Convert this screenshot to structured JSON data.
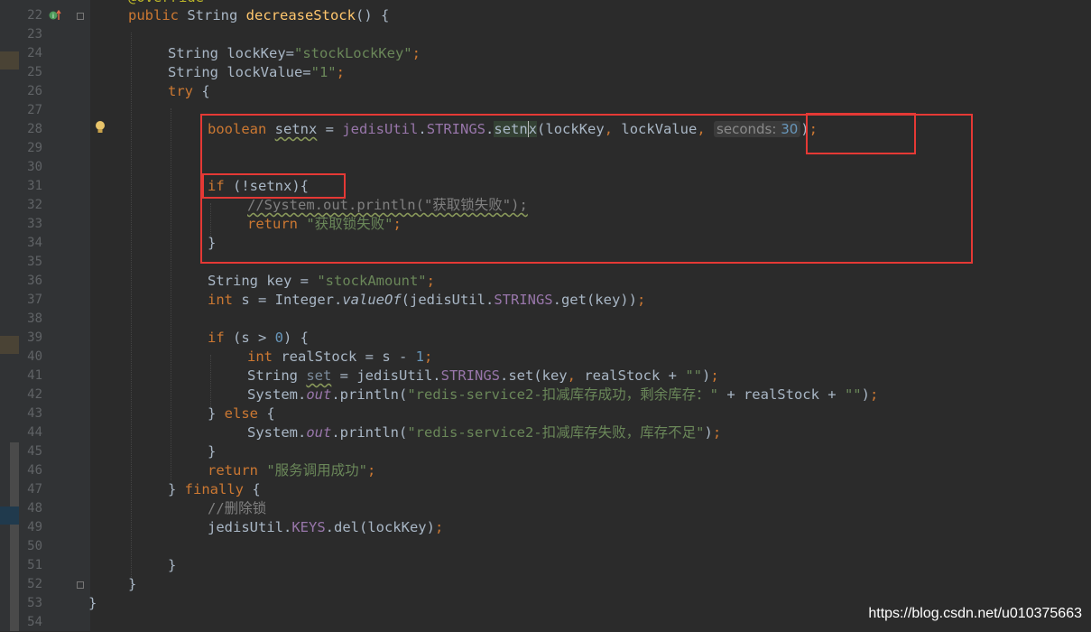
{
  "editor": {
    "line_numbers": [
      "22",
      "23",
      "24",
      "25",
      "26",
      "27",
      "28",
      "29",
      "30",
      "31",
      "32",
      "33",
      "34",
      "35",
      "36",
      "37",
      "38",
      "39",
      "40",
      "41",
      "42",
      "43",
      "44",
      "45",
      "46",
      "47",
      "48",
      "49",
      "50",
      "51",
      "52",
      "53",
      "54"
    ],
    "top_partial": "@Override",
    "line22": {
      "k1": "public ",
      "t1": "String ",
      "m": "decreaseStock",
      "t2": "() {"
    },
    "line24": {
      "t1": "String lockKey=",
      "s": "\"stockLockKey\"",
      "p": ";"
    },
    "line25": {
      "t1": "String lockValue=",
      "s": "\"1\"",
      "p": ";"
    },
    "line26": {
      "k": "try",
      "t": " {"
    },
    "line28": {
      "k": "boolean",
      "sp": " ",
      "v": "setnx",
      "t1": " = ",
      "c": "jedisUtil",
      "d1": ".",
      "f": "STRINGS",
      "d2": ".",
      "m1": "setn",
      "m2": "x",
      "t2": "(lockKey",
      "cm1": ",",
      "t3": " lockValue",
      "cm2": ",",
      "sp2": " ",
      "hint_label": "seconds:",
      "sp3": " ",
      "n": "30",
      "t4": ")",
      "sc": ";"
    },
    "line31": {
      "k": "if",
      "t": " (!setnx){"
    },
    "line32": {
      "c": "//System.out.println(\"获取锁失败\");"
    },
    "line33": {
      "k": "return",
      "sp": " ",
      "s": "\"获取锁失败\"",
      "p": ";"
    },
    "line34": {
      "t": "}"
    },
    "line36": {
      "t1": "String key = ",
      "s": "\"stockAmount\"",
      "p": ";"
    },
    "line37": {
      "k": "int",
      "t1": " s = Integer.",
      "m": "valueOf",
      "t2": "(jedisUtil.",
      "f": "STRINGS",
      "t3": ".get(key))",
      "p": ";"
    },
    "line39": {
      "k": "if",
      "t1": " (s > ",
      "n": "0",
      "t2": ") {"
    },
    "line40": {
      "k": "int",
      "t1": " realStock = s - ",
      "n": "1",
      "p": ";"
    },
    "line41": {
      "t1": "String ",
      "v": "set",
      "t2": " = jedisUtil.",
      "f": "STRINGS",
      "t3": ".set(key",
      "cm": ",",
      "t4": " realStock + ",
      "s": "\"\"",
      "t5": ")",
      "p": ";"
    },
    "line42": {
      "t1": "System.",
      "f": "out",
      "t2": ".println(",
      "s": "\"redis-service2-扣减库存成功，剩余库存：\"",
      "t3": " + realStock + ",
      "s2": "\"\"",
      "t4": ")",
      "p": ";"
    },
    "line43": {
      "t1": "} ",
      "k": "else",
      "t2": " {"
    },
    "line44": {
      "t1": "System.",
      "f": "out",
      "t2": ".println(",
      "s": "\"redis-service2-扣减库存失败，库存不足\"",
      "t3": ")",
      "p": ";"
    },
    "line45": {
      "t": "}"
    },
    "line46": {
      "k": "return",
      "sp": " ",
      "s": "\"服务调用成功\"",
      "p": ";"
    },
    "line47": {
      "t1": "} ",
      "k": "finally",
      "t2": " {"
    },
    "line48": {
      "c": "//删除锁"
    },
    "line49": {
      "t1": "jedisUtil.",
      "f": "KEYS",
      "t2": ".del(lockKey)",
      "p": ";"
    },
    "line51": {
      "t": "}"
    },
    "line52": {
      "t": "}"
    },
    "line53": {
      "t": "}"
    }
  },
  "colors": {
    "background": "#2b2b2b",
    "gutter": "#313335",
    "keyword": "#cc7832",
    "string": "#6a8759",
    "number": "#6897bb",
    "field": "#9876aa",
    "method": "#ffc66d",
    "annotation_box": "#e53935"
  },
  "icons": {
    "override": "override-arrow-icon",
    "bulb": "lightbulb-icon",
    "fold": "fold-marker-icon"
  },
  "watermark": "https://blog.csdn.net/u010375663"
}
